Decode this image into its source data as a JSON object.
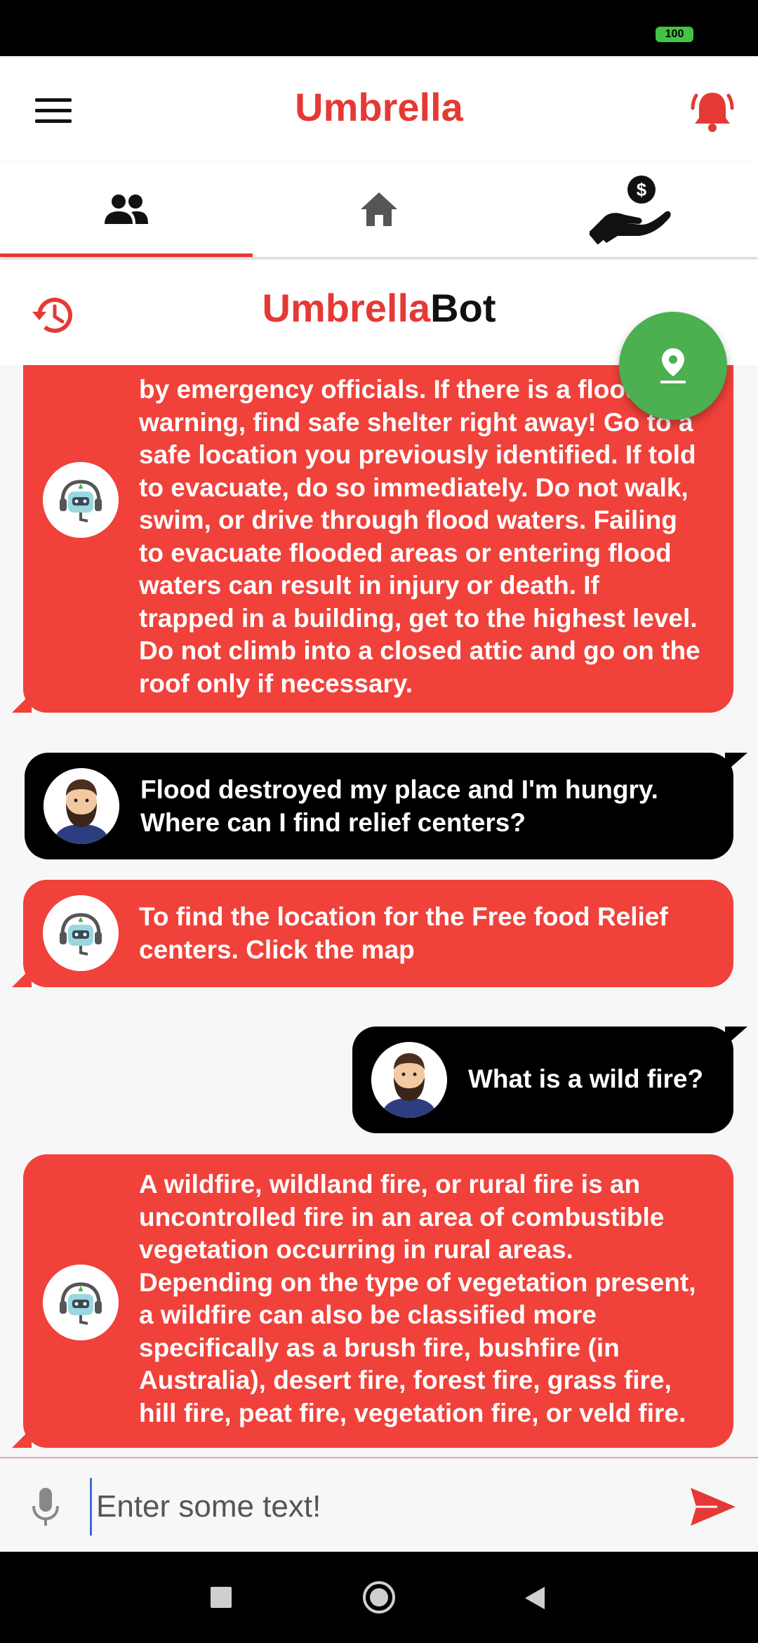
{
  "status_bar": {
    "battery": "100"
  },
  "app_bar": {
    "title": "Umbrella",
    "brand_color": "#e53935"
  },
  "tabs": [
    {
      "icon": "people-icon",
      "active": true
    },
    {
      "icon": "home-icon",
      "active": false
    },
    {
      "icon": "donate-hand-icon",
      "active": false
    }
  ],
  "bot_header": {
    "title_red": "Umbrella",
    "title_black": "Bot"
  },
  "messages": [
    {
      "sender": "bot",
      "avatar": "robot-avatar",
      "lines": [
        "by emergency officials. If there is a flood",
        "warning, find safe shelter right away! Go to a",
        "safe location you previously identified. If told",
        "to evacuate, do so immediately. Do not walk,",
        "swim, or drive through flood waters. Failing",
        "to evacuate flooded areas or entering flood",
        "waters can result in injury or death. If",
        "trapped in a building, get to the highest level.",
        "Do not climb into a closed attic and go on the",
        "roof only if necessary."
      ]
    },
    {
      "sender": "user",
      "avatar": "bearded-man-avatar",
      "lines": [
        "Flood destroyed my place and I'm hungry.",
        "Where can I find relief centers?"
      ]
    },
    {
      "sender": "bot",
      "avatar": "robot-avatar",
      "lines": [
        "To find the location for the Free food Relief",
        "centers. Click the map"
      ]
    },
    {
      "sender": "user",
      "avatar": "bearded-man-avatar",
      "lines": [
        "What is a wild fire?"
      ]
    },
    {
      "sender": "bot",
      "avatar": "robot-avatar",
      "lines": [
        "A wildfire, wildland fire, or rural fire is an",
        "uncontrolled fire in an area of combustible",
        "vegetation occurring in rural areas.",
        "Depending on the type of vegetation present,",
        "a wildfire can also be classified more",
        "specifically as a brush fire, bushfire (in",
        "Australia), desert fire, forest fire, grass fire,",
        "hill fire, peat fire, vegetation fire, or veld fire."
      ]
    }
  ],
  "input": {
    "placeholder": "Enter some text!",
    "value": ""
  },
  "colors": {
    "bot_bubble": "#f0413a",
    "user_bubble": "#000000",
    "fab": "#4caf50"
  }
}
